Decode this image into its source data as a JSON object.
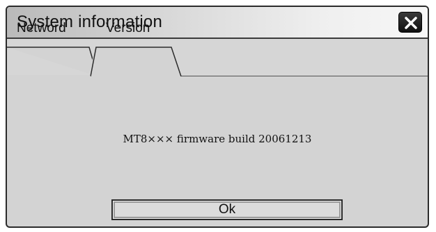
{
  "dialog": {
    "title": "System information",
    "close_icon": "close-x-icon"
  },
  "tabs": [
    {
      "label": "Netword",
      "active": false
    },
    {
      "label": "Version",
      "active": true
    }
  ],
  "content": {
    "firmware_text": "MT8×××  firmware  build 20061213"
  },
  "buttons": {
    "ok_label": "Ok"
  },
  "colors": {
    "panel": "#d3d3d3",
    "border": "#2b2b2b",
    "close_button": "#1a1a1a"
  }
}
